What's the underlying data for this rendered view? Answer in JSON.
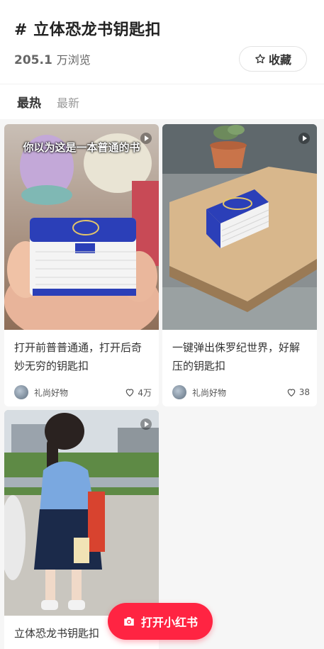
{
  "header": {
    "title": "# 立体恐龙书钥匙扣",
    "views_number": "205.1",
    "views_unit": "万浏览",
    "favorite_label": "收藏"
  },
  "tabs": [
    {
      "label": "最热",
      "active": true
    },
    {
      "label": "最新",
      "active": false
    }
  ],
  "cards": [
    {
      "overlay_text": "你以为这是一本普通的书",
      "desc": "打开前普普通通，打开后奇妙无穷的钥匙扣",
      "author": "礼尚好物",
      "likes": "4万",
      "is_video": true
    },
    {
      "desc": "一键弹出侏罗纪世界，好解压的钥匙扣",
      "author": "礼尚好物",
      "likes": "38",
      "is_video": true
    },
    {
      "desc": "立体恐龙书钥匙扣",
      "is_video": true
    }
  ],
  "open_app": {
    "label": "打开小红书"
  },
  "colors": {
    "brand": "#ff2442",
    "book_blue": "#2b3fb8",
    "background": "#f6f6f6"
  }
}
